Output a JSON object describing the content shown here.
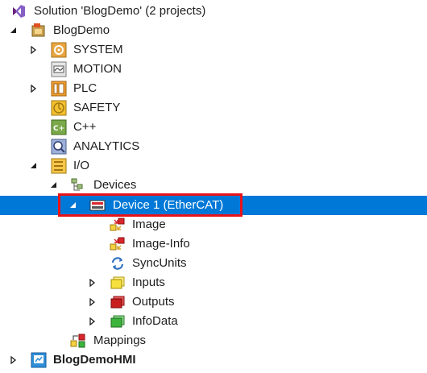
{
  "tree": {
    "solution_label": "Solution 'BlogDemo' (2 projects)",
    "project_label": "BlogDemo",
    "system_label": "SYSTEM",
    "motion_label": "MOTION",
    "plc_label": "PLC",
    "safety_label": "SAFETY",
    "cpp_label": "C++",
    "analytics_label": "ANALYTICS",
    "io_label": "I/O",
    "devices_label": "Devices",
    "device1_label": "Device 1 (EtherCAT)",
    "image_label": "Image",
    "image_info_label": "Image-Info",
    "syncunits_label": "SyncUnits",
    "inputs_label": "Inputs",
    "outputs_label": "Outputs",
    "infodata_label": "InfoData",
    "mappings_label": "Mappings",
    "hmi_label": "BlogDemoHMI"
  },
  "colors": {
    "selection": "#0078d7",
    "highlight_border": "#e8131a"
  },
  "icons": {
    "solution": "visual-studio-solution-icon",
    "project": "twincat-project-icon",
    "system": "system-icon",
    "motion": "motion-icon",
    "plc": "plc-icon",
    "safety": "safety-icon",
    "cpp": "cpp-icon",
    "analytics": "analytics-icon",
    "io": "io-icon",
    "devices": "devices-icon",
    "device": "ethercat-device-icon",
    "image": "image-icon",
    "image_info": "image-info-icon",
    "syncunits": "syncunits-icon",
    "inputs": "inputs-icon",
    "outputs": "outputs-icon",
    "infodata": "infodata-icon",
    "mappings": "mappings-icon",
    "hmi": "hmi-project-icon"
  }
}
